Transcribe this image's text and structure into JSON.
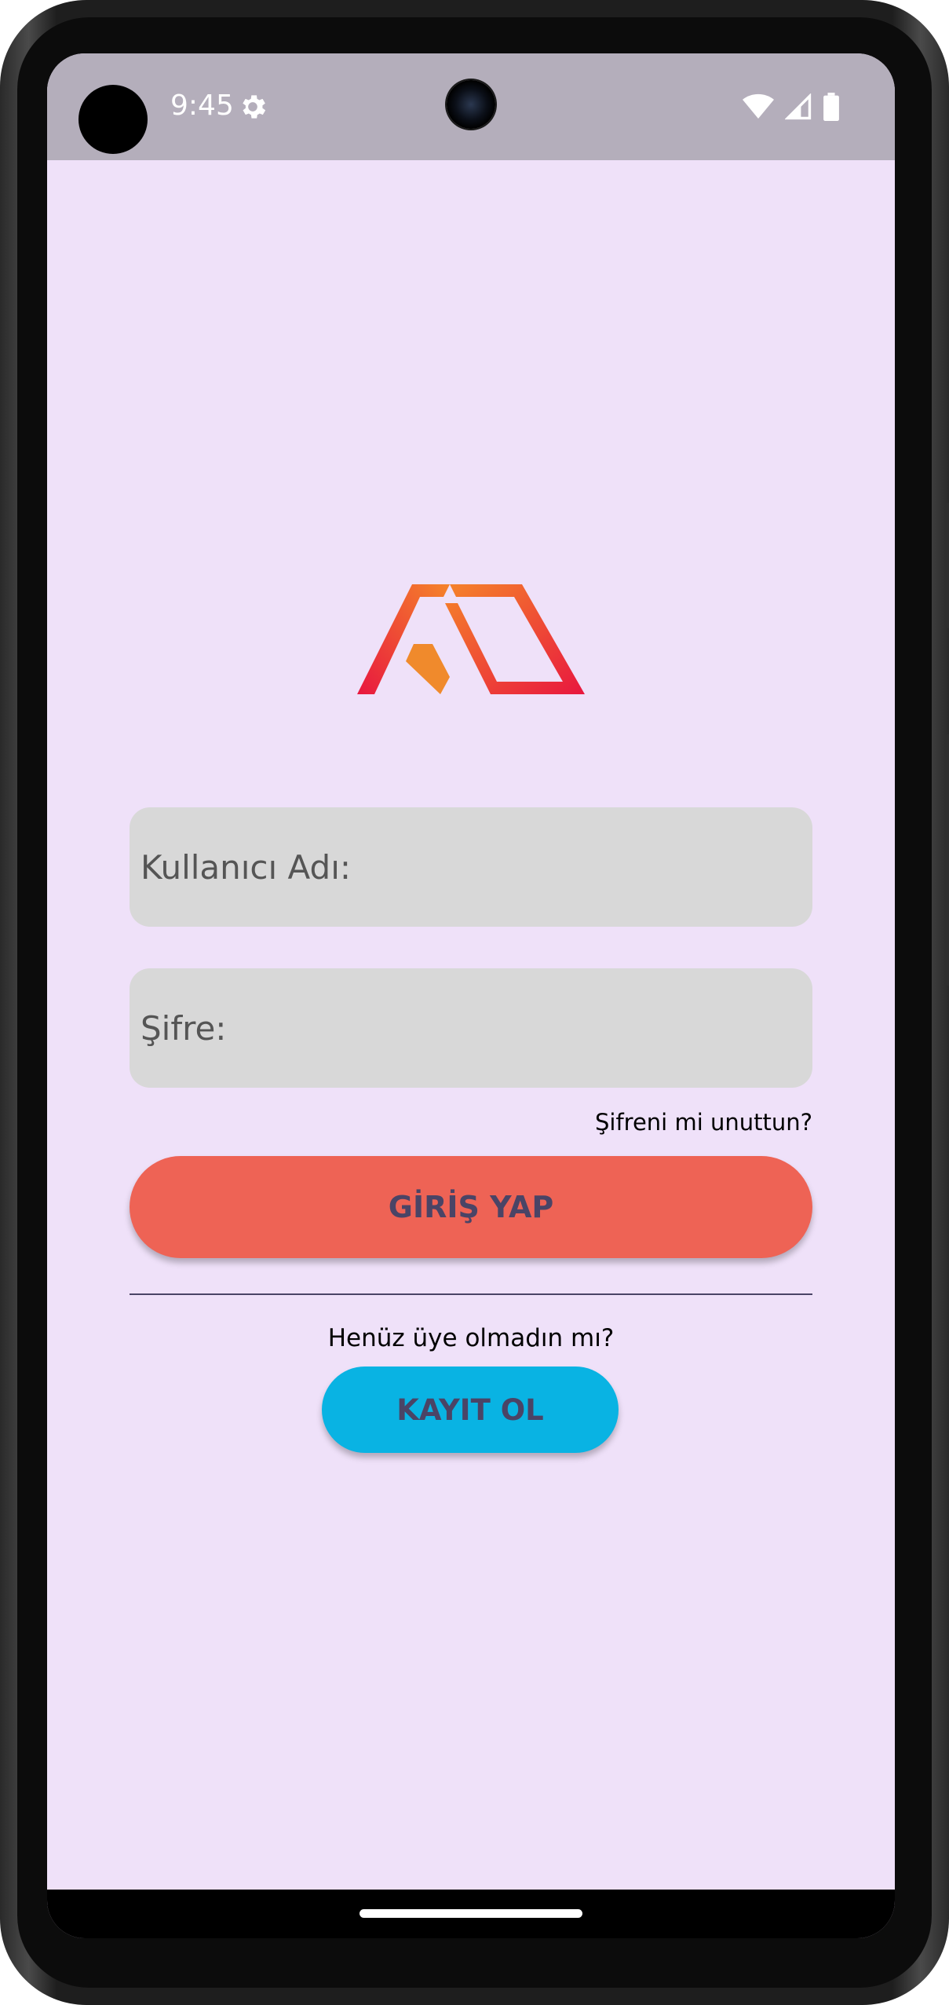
{
  "status_bar": {
    "time": "9:45",
    "icons": [
      "settings-gear-icon",
      "wifi-icon",
      "signal-icon",
      "battery-icon"
    ]
  },
  "logo": {
    "name": "AD logo",
    "colors": [
      "#e8173f",
      "#f5842a"
    ]
  },
  "form": {
    "username_placeholder": "Kullanıcı Adı:",
    "password_placeholder": "Şifre:",
    "forgot_password": "Şifreni mi unuttun?",
    "login_button": "GİRİŞ YAP"
  },
  "signup": {
    "prompt": "Henüz üye olmadın mı?",
    "button": "KAYIT OL"
  },
  "colors": {
    "background": "#efe1f9",
    "field": "#d8d8d8",
    "login_button": "#ee6355",
    "signup_button": "#09b3e3",
    "button_text": "#4a4466"
  }
}
